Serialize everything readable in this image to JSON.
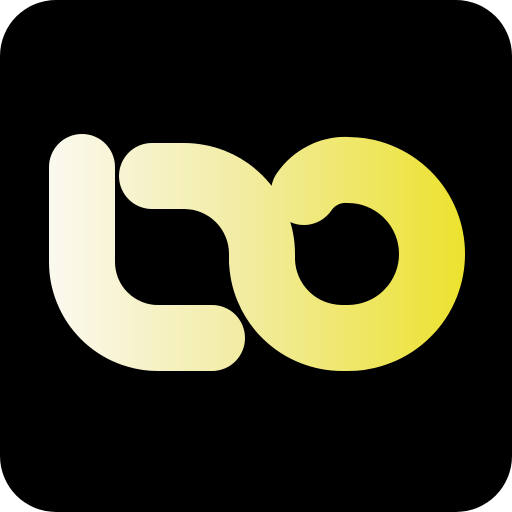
{
  "icon": {
    "name": "app-logo-icon",
    "background_color": "#000000",
    "frame_color": "#ffffff",
    "gradient_start_color": "#fbf9ef",
    "gradient_mid_color": "#f2eca4",
    "gradient_end_color": "#ece22c"
  }
}
